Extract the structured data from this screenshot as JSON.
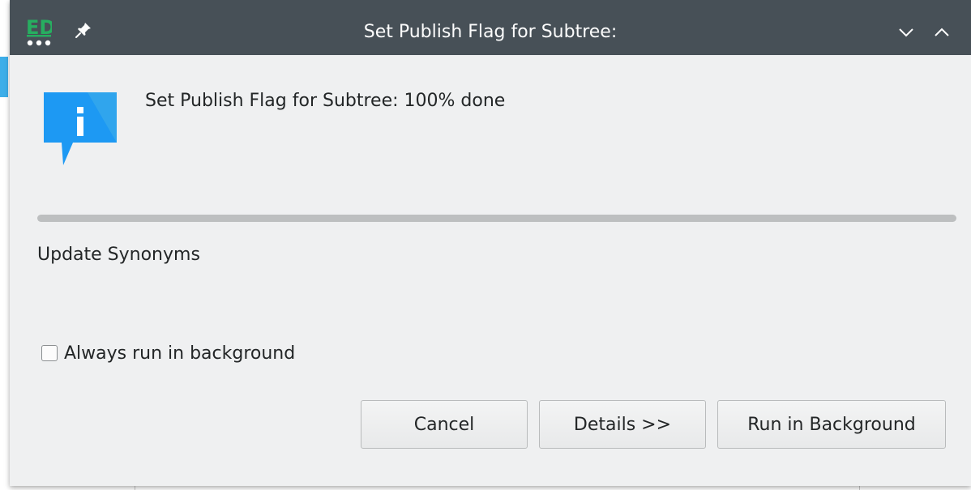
{
  "window": {
    "title": "Set Publish Flag for Subtree:",
    "app_icon_text": "ED"
  },
  "message": "Set Publish Flag for Subtree:  100% done",
  "progress": {
    "percent": 100
  },
  "subtask": "Update Synonyms",
  "checkbox": {
    "label": "Always run in background",
    "checked": false
  },
  "buttons": {
    "cancel": "Cancel",
    "details": "Details >>",
    "run_background": "Run in Background"
  },
  "colors": {
    "titlebar": "#475057",
    "accent": "#3daee9",
    "app_icon": "#27ae60",
    "info_icon": "#1d99f3"
  }
}
